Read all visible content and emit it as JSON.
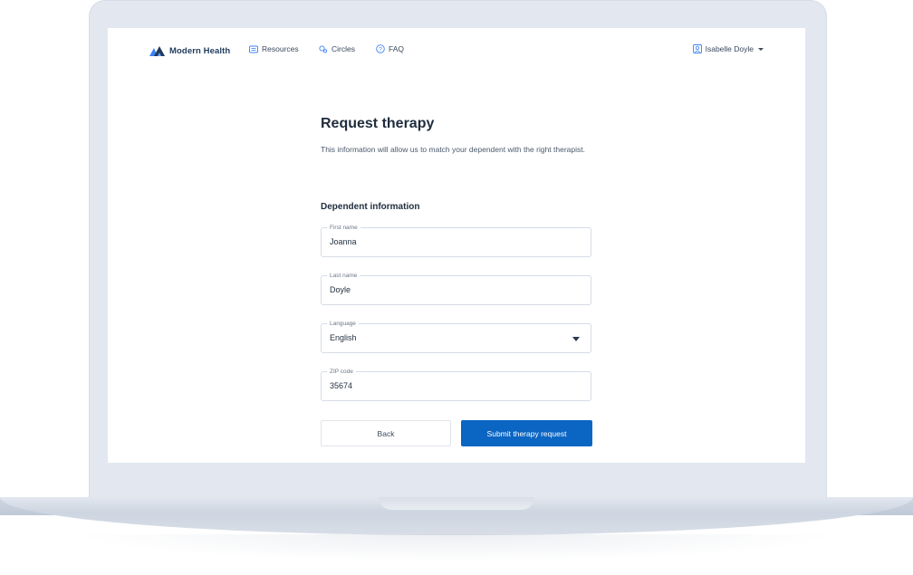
{
  "nav": {
    "brand": "Modern Health",
    "links": [
      {
        "label": "Resources",
        "icon": "book-icon"
      },
      {
        "label": "Circles",
        "icon": "circles-icon"
      },
      {
        "label": "FAQ",
        "icon": "question-circle-icon"
      }
    ],
    "user": {
      "name": "Isabelle Doyle",
      "icon": "user-icon"
    }
  },
  "form": {
    "title": "Request therapy",
    "description": "This information will allow us to match your dependent with the right therapist.",
    "section_title": "Dependent information",
    "fields": {
      "first_name": {
        "label": "First name",
        "value": "Joanna"
      },
      "last_name": {
        "label": "Last name",
        "value": "Doyle"
      },
      "language": {
        "label": "Language",
        "value": "English"
      },
      "zip": {
        "label": "ZIP code",
        "value": "35674"
      }
    },
    "back_label": "Back",
    "submit_label": "Submit therapy request"
  },
  "colors": {
    "brand": "#1f3a5c",
    "logo_accent": "#3b82f6",
    "primary": "#0b65c2",
    "frame": "#e3e8f0"
  }
}
